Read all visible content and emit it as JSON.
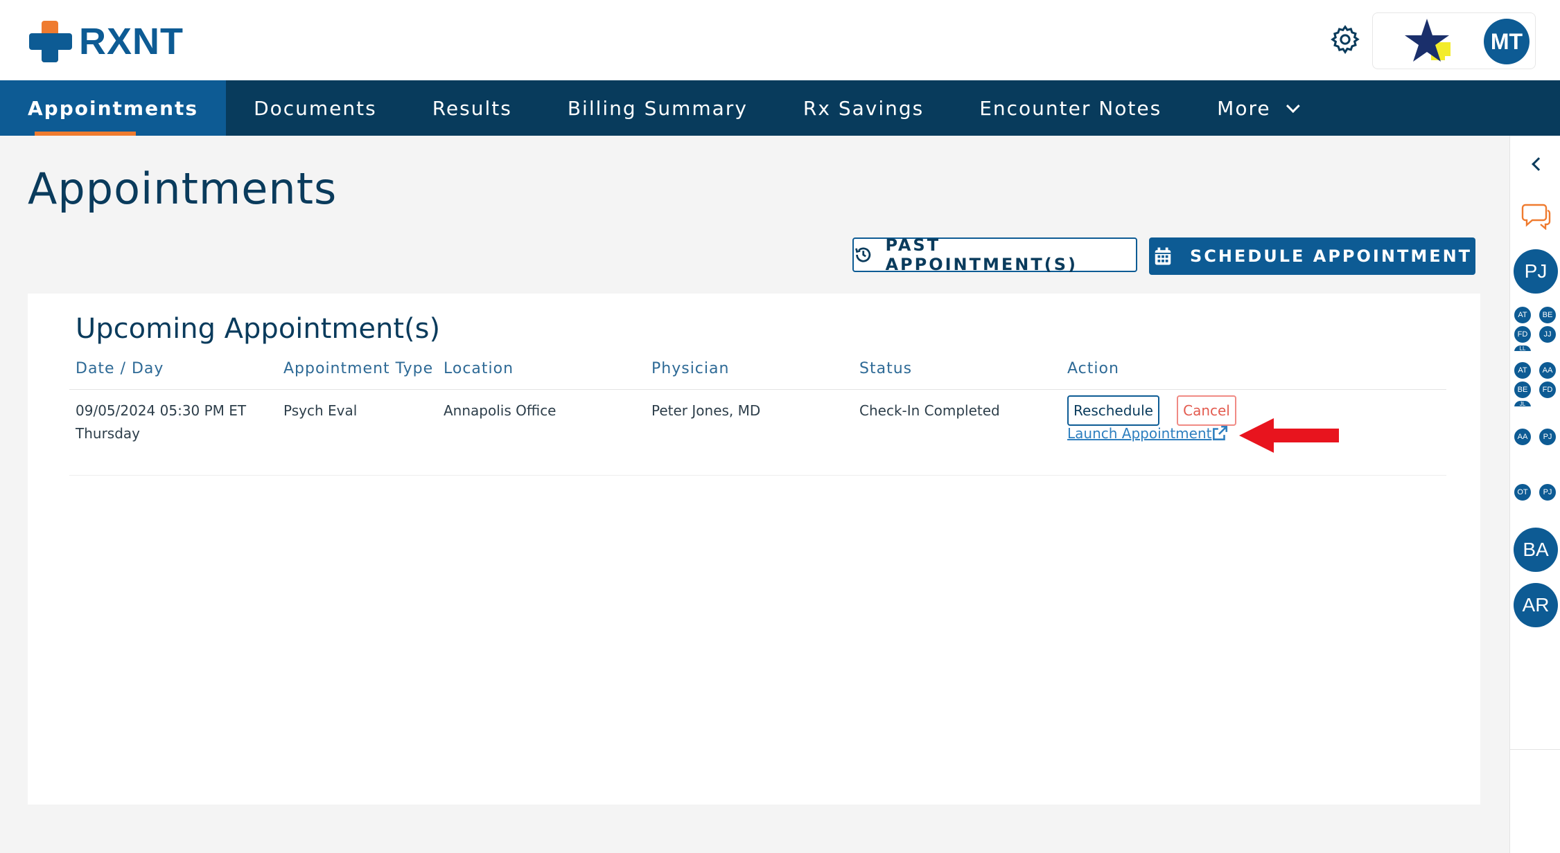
{
  "brand": {
    "name": "RXNT"
  },
  "header": {
    "settings_icon": "gear-icon",
    "user_initials": "MT",
    "badge_icon": "star-icon"
  },
  "nav": {
    "items": [
      {
        "label": "Appointments",
        "active": true
      },
      {
        "label": "Documents"
      },
      {
        "label": "Results"
      },
      {
        "label": "Billing Summary"
      },
      {
        "label": "Rx Savings"
      },
      {
        "label": "Encounter Notes"
      },
      {
        "label": "More"
      }
    ]
  },
  "page": {
    "title": "Appointments",
    "past_button": "PAST APPOINTMENT(S)",
    "schedule_button": "SCHEDULE APPOINTMENT"
  },
  "upcoming": {
    "title": "Upcoming Appointment(s)",
    "columns": [
      "Date / Day",
      "Appointment Type",
      "Location",
      "Physician",
      "Status",
      "Action"
    ],
    "rows": [
      {
        "date": "09/05/2024 05:30 PM ET",
        "day": "Thursday",
        "type": "Psych Eval",
        "location": "Annapolis Office",
        "physician": "Peter Jones, MD",
        "status": "Check-In Completed",
        "reschedule_label": "Reschedule",
        "cancel_label": "Cancel",
        "launch_label": "Launch Appointment"
      }
    ]
  },
  "sidebar": {
    "chat_icon": "chat-icon",
    "avatars": {
      "pj": "PJ",
      "group1": [
        "AT",
        "BE",
        "FD",
        "JJ",
        "LL"
      ],
      "group2": [
        "AT",
        "AA",
        "BE",
        "FD",
        "JL"
      ],
      "pair1": [
        "AA",
        "PJ"
      ],
      "pair2": [
        "OT",
        "PJ"
      ],
      "ba": "BA",
      "ar": "AR"
    }
  },
  "colors": {
    "nav_bg": "#083b5c",
    "nav_active": "#0d5b94",
    "accent_orange": "#ef7b2f",
    "cancel_red": "#e35b4f",
    "arrow_red": "#e8141e"
  }
}
